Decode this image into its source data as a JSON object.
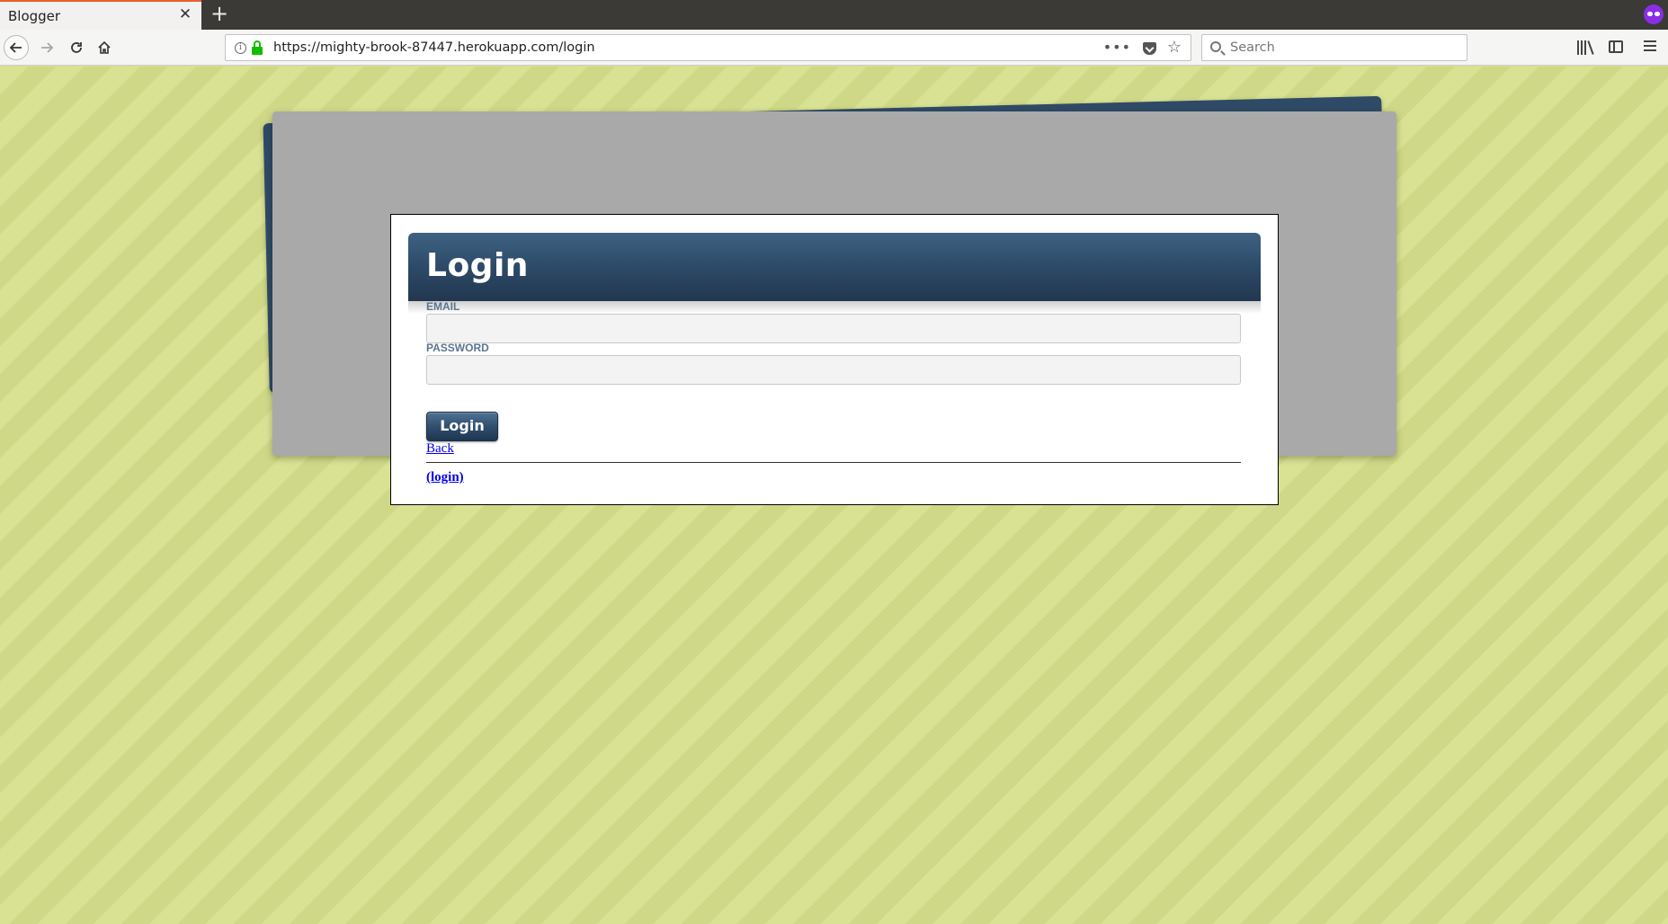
{
  "browser": {
    "tab": {
      "title": "Blogger",
      "close_glyph": "✕"
    },
    "new_tab_glyph": "+",
    "url": "https://mighty-brook-87447.herokuapp.com/login",
    "url_more_glyph": "•••",
    "search_placeholder": "Search",
    "icons": {
      "back": "back-arrow-icon",
      "forward": "forward-arrow-icon",
      "reload": "reload-icon",
      "home": "home-icon",
      "info": "info-icon",
      "lock": "lock-icon",
      "pocket": "pocket-icon",
      "bookmark": "star-icon",
      "search": "search-icon",
      "library": "library-icon",
      "sidebar": "sidebar-icon",
      "menu": "menu-icon",
      "private": "private-browsing-icon"
    }
  },
  "page": {
    "title": "Login",
    "form": {
      "email_label": "EMAIL",
      "email_value": "",
      "password_label": "PASSWORD",
      "password_value": "",
      "submit_label": "Login"
    },
    "back_link": "Back",
    "login_link": "(login)"
  },
  "colors": {
    "header_dark": "#22374f",
    "header_light": "#3f6283",
    "link": "#0000ee",
    "background_stripe_a": "#d9e293",
    "background_stripe_b": "#cfd887",
    "panel_gray": "#a9a9a9",
    "label": "#5a7590",
    "secure_lock": "#12bc00"
  }
}
